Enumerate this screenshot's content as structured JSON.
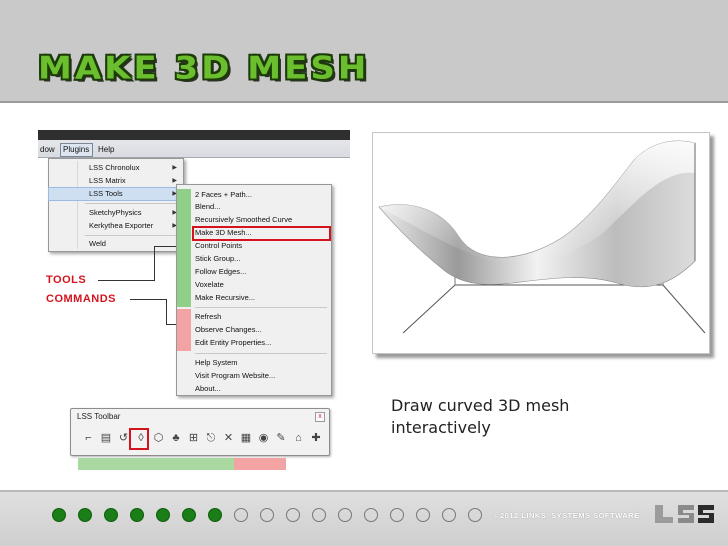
{
  "slide": {
    "title": "Make 3D Mesh",
    "caption_line1": "Draw curved 3D mesh",
    "caption_line2": "interactively"
  },
  "menubar": {
    "items": [
      "dow",
      "Plugins",
      "Help"
    ]
  },
  "plugins_menu": {
    "items": [
      {
        "label": "LSS Chronolux",
        "submenu": true
      },
      {
        "label": "LSS Matrix",
        "submenu": true
      },
      {
        "label": "LSS Tools",
        "submenu": true,
        "highlighted": true
      },
      {
        "label": "SketchyPhysics",
        "submenu": true
      },
      {
        "label": "Kerkythea Exporter",
        "submenu": true
      },
      {
        "label": "Weld",
        "submenu": false
      }
    ]
  },
  "tools_submenu": {
    "items": [
      "2 Faces + Path...",
      "Blend...",
      "Recursively Smoothed Curve",
      "Make 3D Mesh...",
      "Control Points",
      "Stick Group...",
      "Follow Edges...",
      "Voxelate",
      "Make Recursive...",
      "Refresh",
      "Observe Changes...",
      "Edit Entity Properties...",
      "Help System",
      "Visit Program Website...",
      "About..."
    ],
    "selected": "Make 3D Mesh..."
  },
  "labels": {
    "tools": "TOOLS",
    "commands": "COMMANDS"
  },
  "toolbar": {
    "title": "LSS Toolbar",
    "close": "x",
    "icons": [
      "control-points-icon",
      "stick-group-icon",
      "follow-edges-icon",
      "blend-icon",
      "make-3d-mesh-icon",
      "voxelate-icon",
      "make-recursive-icon",
      "recursive-curve-icon",
      "two-faces-path-icon",
      "refresh-icon",
      "observe-icon",
      "edit-properties-icon",
      "help-icon",
      "about-icon"
    ],
    "icon_glyphs": [
      "⌐",
      "▤",
      "↺",
      "◊",
      "⬡",
      "♣",
      "⊞",
      "⎋",
      "✕",
      "▦",
      "◉",
      "✎",
      "⌂",
      "✚"
    ],
    "selected_index": 4
  },
  "footer": {
    "copyright": "©2012 LINKS' SYSTEMS SOFTWARE",
    "logo_text": "LSS",
    "progress_filled": 7,
    "progress_total": 17
  },
  "colors": {
    "title_green": "#6bbf2e",
    "accent_red": "#d4141d",
    "tools_green": "#8fcf8a",
    "commands_pink": "#f3a3a3",
    "dot_green": "#1a7d18"
  }
}
